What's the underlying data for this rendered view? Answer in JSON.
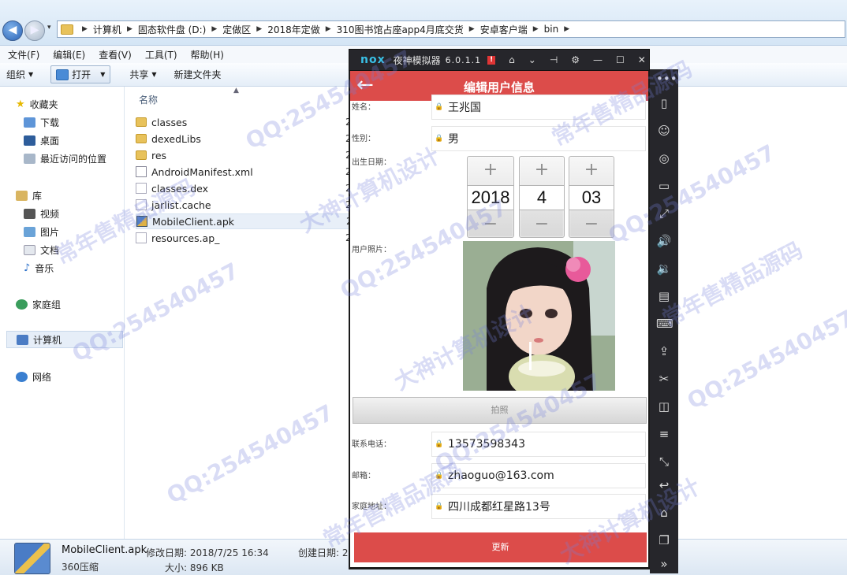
{
  "address_bar": {
    "crumbs": [
      "计算机",
      "固态软件盘 (D:)",
      "定做区",
      "2018年定做",
      "310图书馆占座app4月底交货",
      "安卓客户端",
      "bin"
    ]
  },
  "menu": [
    "文件(F)",
    "编辑(E)",
    "查看(V)",
    "工具(T)",
    "帮助(H)"
  ],
  "toolbar": {
    "organize": "组织",
    "open": "打开",
    "share": "共享",
    "new_folder": "新建文件夹"
  },
  "nav": {
    "favorites": "收藏夹",
    "downloads": "下载",
    "desktop": "桌面",
    "recent": "最近访问的位置",
    "libraries": "库",
    "videos": "视频",
    "pictures": "图片",
    "documents": "文档",
    "music": "音乐",
    "homegroup": "家庭组",
    "computer": "计算机",
    "network": "网络"
  },
  "file_list": {
    "column_name": "名称",
    "files": [
      {
        "name": "classes",
        "icon": "folder-icon"
      },
      {
        "name": "dexedLibs",
        "icon": "folder-icon"
      },
      {
        "name": "res",
        "icon": "folder-icon"
      },
      {
        "name": "AndroidManifest.xml",
        "icon": "xml-file-icon"
      },
      {
        "name": "classes.dex",
        "icon": "file-icon"
      },
      {
        "name": "jarlist.cache",
        "icon": "file-icon"
      },
      {
        "name": "MobileClient.apk",
        "icon": "apk-file-icon"
      },
      {
        "name": "resources.ap_",
        "icon": "file-icon"
      }
    ],
    "trail": "2"
  },
  "details_pane": {
    "file_name": "MobileClient.apk",
    "file_type": "360压缩",
    "modified": "修改日期: 2018/7/25 16:34",
    "size": "大小: 896 KB",
    "created": "创建日期: 2"
  },
  "emulator": {
    "logo": "nox",
    "name": "夜神模拟器",
    "version": "6.0.1.1"
  },
  "app": {
    "title": "编辑用户信息",
    "labels": {
      "name": "姓名：",
      "gender": "性别：",
      "birthdate": "出生日期：",
      "photo": "用户照片：",
      "phone": "联系电话：",
      "email": "邮箱：",
      "address": "家庭地址："
    },
    "values": {
      "name": "王兆国",
      "gender": "男",
      "phone": "13573598343",
      "email": "zhaoguo@163.com",
      "address": "四川成都红星路13号"
    },
    "date_picker": {
      "year": "2018",
      "month": "4",
      "day": "03",
      "plus": "+",
      "minus": "−"
    },
    "photo_button": "拍照",
    "update_button": "更新"
  },
  "watermark": [
    "QQ:254540457",
    "大神计算机设计",
    "常年售精品源码"
  ],
  "colors": {
    "app_accent": "#dc4c4a",
    "emulator_chrome": "#26262b",
    "nox_logo": "#39c0e6"
  }
}
